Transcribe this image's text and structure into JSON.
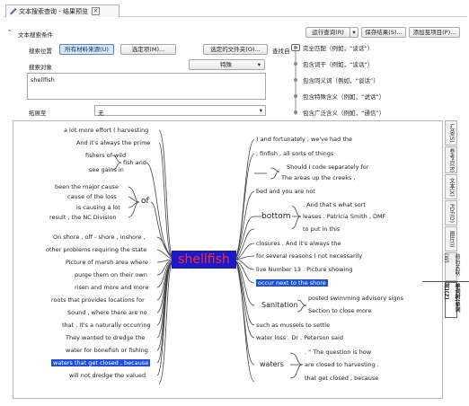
{
  "tab": {
    "title": "文本搜索查询 - 结果预览",
    "close": "×"
  },
  "toolbar": {
    "run": "运行查询(R)",
    "run_arrow": "▾",
    "save": "保存结果(S)...",
    "add_project": "添加至项目(P)..."
  },
  "criteria": {
    "header": "文本搜索条件",
    "location_label": "搜索位置",
    "all_sources": "所有材料来源(U)",
    "selected_items": "选定项(M)...",
    "selected_folders": "选定的文件夹(O)...",
    "search_object_label": "搜索对象",
    "special": "特殊",
    "special_arrow": "▾",
    "search_text": "shellfish",
    "extend_label": "拓展至",
    "extend_value": "无",
    "extend_arrow": "▾",
    "find_label": "查找自",
    "options": [
      "完全匹配（例如，“谈话”）",
      "包含词干（例如，“谈话”）",
      "包含同义词（例如，“谈话”）",
      "包含特殊含义（例如，“说话”）",
      "包含广泛含义（例如，“通信”）"
    ]
  },
  "mindmap": {
    "center": "shellfish",
    "left": [
      "a lot more effort ( harvesting",
      "And it's always the prime",
      "fishers of wild",
      "see gains in",
      "fish and",
      "been the major cause",
      "cause of the loss",
      "is causing a lot",
      "result , the NC Division",
      "of",
      "On shore , off - shore , inshore ,",
      "other problems requiring the state",
      "Picture of marsh area where",
      "purge them on their own",
      "risen and more and more",
      "roots that provides locations for",
      "Sound , where there are no",
      "that . It's a naturally occurring",
      "They wanted to dredge the",
      "water for bonefish or fishing",
      "waters that get closed , because",
      "will not dredge the valued"
    ],
    "right": [
      ") and fortunately , we've had the",
      ", finfish , all sorts of things",
      "Should I code separately for",
      "The areas up the creeks ,",
      "bed and you are not",
      ". And that's what sort",
      "leases . Patricia Smith , DMF",
      "to put in this",
      "bottom",
      "closures . And it's always the",
      "for several reasons ( not necessarily",
      "live Number 13 . Picture showing",
      "occur next to the shore",
      "posted swimming advisory signs",
      "Section to close more",
      "Sanitation",
      "such as mussels to settle",
      "water loss . Dr . Peterson said",
      ". \" The question is how",
      "are closed to harvesting .",
      "that get closed , because",
      "waters"
    ]
  },
  "side_tabs": [
    "汇总(S)",
    "参考点(R)",
    "文本(X)",
    "PDF(D)",
    "图片(I)",
    "前后关联(W)",
    "单词树(单词树)(Z)"
  ]
}
